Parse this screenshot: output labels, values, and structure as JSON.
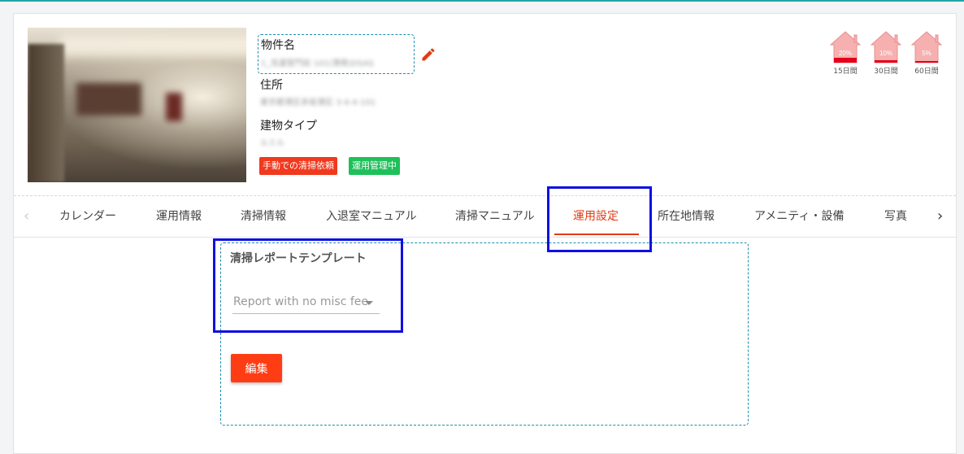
{
  "property": {
    "name_label": "物件名",
    "name_value": "1_洗濯室門前 101(港南)DSAS",
    "address_label": "住所",
    "address_value": "東京都港区赤坂港区 3-4-4-101",
    "building_type_label": "建物タイプ",
    "building_type_value": "ルミル",
    "badges": [
      "手動での清掃依頼",
      "運用管理中"
    ]
  },
  "occupancy": [
    {
      "percent": "20%",
      "days": "15日間",
      "fill": 0.2
    },
    {
      "percent": "10%",
      "days": "30日間",
      "fill": 0.1
    },
    {
      "percent": "5%",
      "days": "60日間",
      "fill": 0.05
    }
  ],
  "tabs": [
    "カレンダー",
    "運用情報",
    "清掃情報",
    "入退室マニュアル",
    "清掃マニュアル",
    "運用設定",
    "所在地情報",
    "アメニティ・設備",
    "写真"
  ],
  "active_tab": "運用設定",
  "settings": {
    "section_title": "清掃レポートテンプレート",
    "template_select_value": "Report with no misc fee",
    "edit_button": "編集"
  },
  "colors": {
    "accent": "#ff3d14",
    "active_tab": "#e23a12",
    "badge_manual": "#f0391e",
    "badge_managed": "#1fc05a",
    "highlight": "#1010e0"
  }
}
